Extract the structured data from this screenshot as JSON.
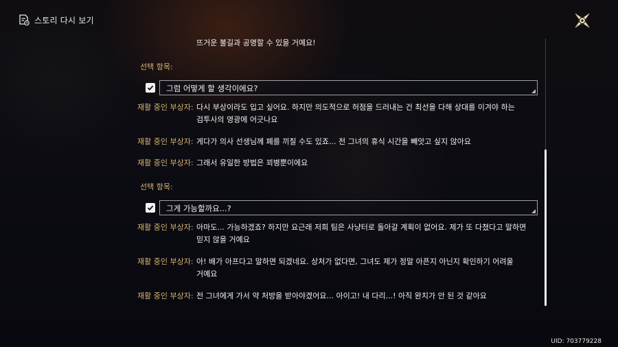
{
  "header": {
    "title": "스토리 다시 보기",
    "icon": "story-replay-icon"
  },
  "close": {
    "icon": "close-x-icon"
  },
  "log": {
    "top_line": "뜨거운 불길과 공명할 수 있을 거예요!",
    "choice_label": "선택 항목:",
    "choice1": "그럼 어떻게 할 생각이에요?",
    "speaker": "재활 중인 부상자:",
    "line1a": "다시 부상이라도 입고 싶어요. 하지만 의도적으로 허점을 드러내는 건 최선을 다해 상대를 이겨야 하는",
    "line1b": "검투사의 영광에 어긋나요",
    "line2": "게다가 의사 선생님께 폐를 끼칠 수도 있죠... 전 그녀의 휴식 시간을 빼앗고 싶지 않아요",
    "line3": "그래서 유일한 방법은 꾀병뿐이에요",
    "choice2": "그게 가능할까요...?",
    "line4a": "아마도... 가능하겠죠? 하지만 요근래 저희 팀은 사냥터로 돌아갈 계획이 없어요. 제가 또 다쳤다고 말하면",
    "line4b": "믿지 않을 거예요",
    "line5a": "아! 배가 아프다고 말하면 되겠네요. 상처가 없다면, 그녀도 제가 정말 아픈지 아닌지 확인하기 어려울",
    "line5b": "거예요",
    "line6": "전 그녀에게 가서 약 처방을 받아야겠어요... 아이고! 내 다리...! 아직 완치가 안 된 것 같아요"
  },
  "uid": "UID: 703779228",
  "colors": {
    "speaker": "#d8b474",
    "text": "#f0f0f0",
    "box_border": "#d2d2dc"
  }
}
